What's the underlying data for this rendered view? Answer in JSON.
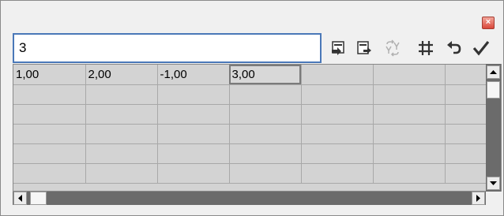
{
  "window": {
    "close_glyph": "×"
  },
  "input": {
    "value": "3"
  },
  "toolbar": {
    "buttons": [
      {
        "name": "import-icon",
        "enabled": true
      },
      {
        "name": "export-icon",
        "enabled": true
      },
      {
        "name": "swap-icon",
        "enabled": false
      },
      {
        "name": "columns-icon",
        "enabled": true
      },
      {
        "name": "undo-icon",
        "enabled": true
      },
      {
        "name": "check-icon",
        "enabled": true
      }
    ]
  },
  "grid": {
    "rows": [
      [
        "1,00",
        "2,00",
        "-1,00",
        "3,00",
        "",
        "",
        ""
      ],
      [
        "",
        "",
        "",
        "",
        "",
        "",
        ""
      ],
      [
        "",
        "",
        "",
        "",
        "",
        "",
        ""
      ],
      [
        "",
        "",
        "",
        "",
        "",
        "",
        ""
      ],
      [
        "",
        "",
        "",
        "",
        "",
        "",
        ""
      ],
      [
        "",
        "",
        "",
        "",
        "",
        "",
        ""
      ]
    ],
    "selected_cell": [
      0,
      3
    ]
  },
  "colors": {
    "input_border": "#4a78b8",
    "cell_background": "#d3d3d3",
    "scroll_track": "#6b6b6b"
  }
}
